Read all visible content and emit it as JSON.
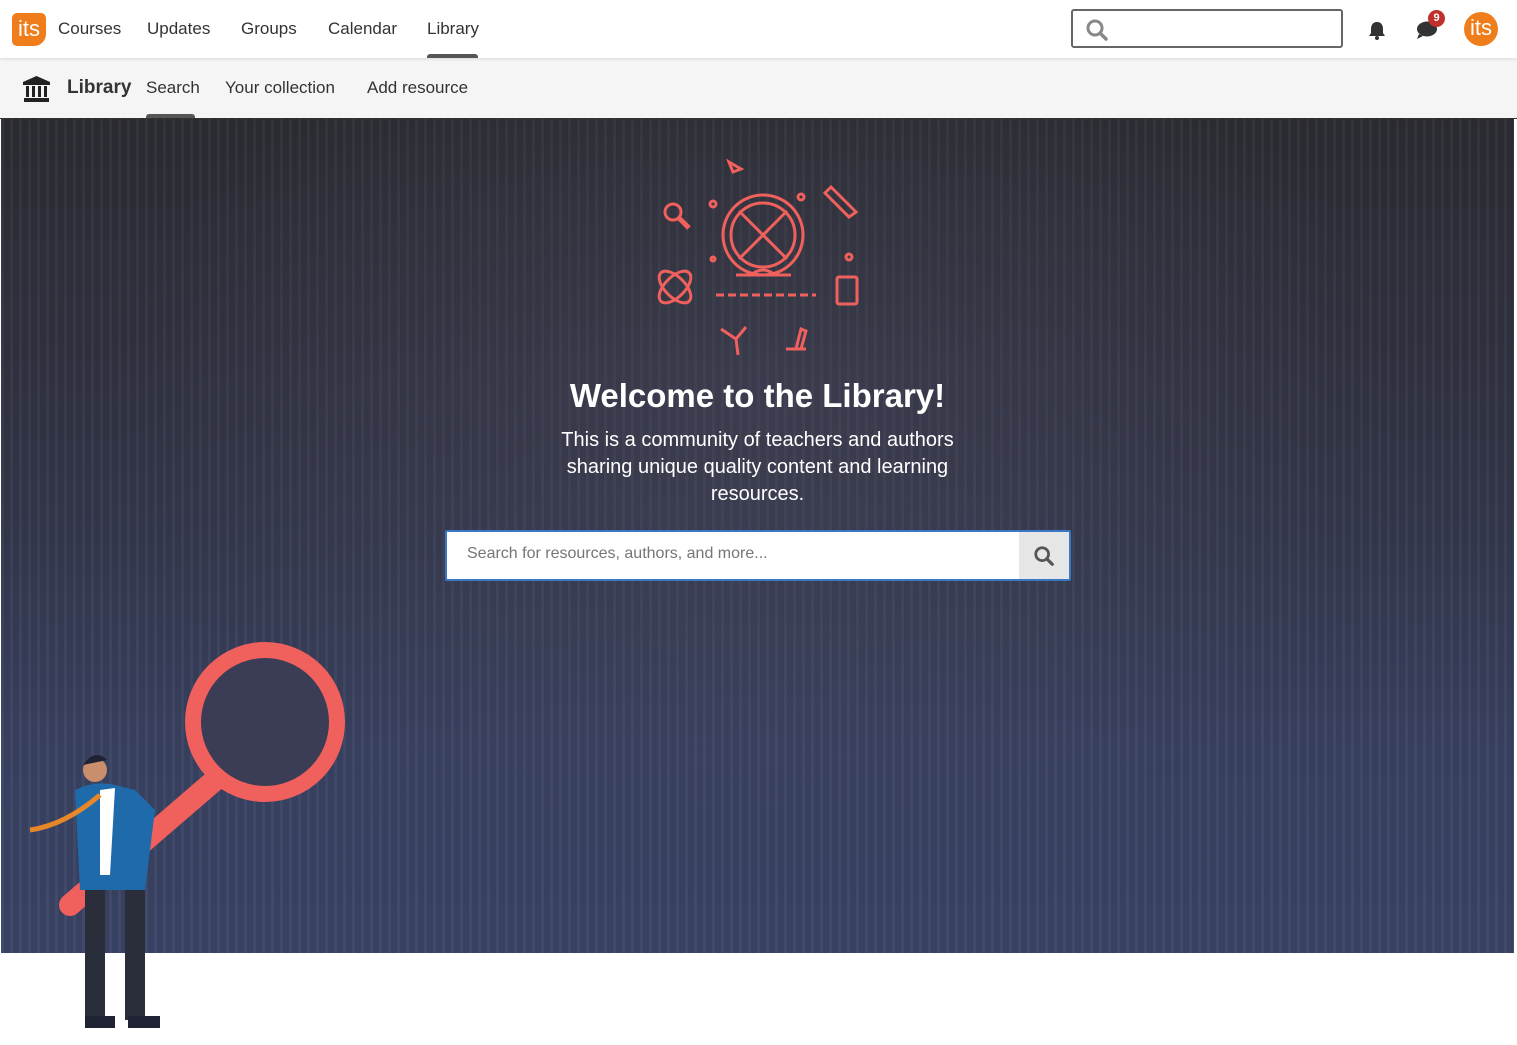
{
  "header": {
    "logo": "its",
    "nav": [
      "Courses",
      "Updates",
      "Groups",
      "Calendar",
      "Library"
    ],
    "active": "Library",
    "notifications_badge": "9",
    "avatar": "its"
  },
  "subnav": {
    "title": "Library",
    "items": [
      "Search",
      "Your collection",
      "Add resource"
    ],
    "active": "Search"
  },
  "hero": {
    "title": "Welcome to the Library!",
    "description": "This is a community of teachers and authors sharing unique quality content and learning resources.",
    "search_placeholder": "Search for resources, authors, and more...",
    "accent": "#f0605d"
  }
}
